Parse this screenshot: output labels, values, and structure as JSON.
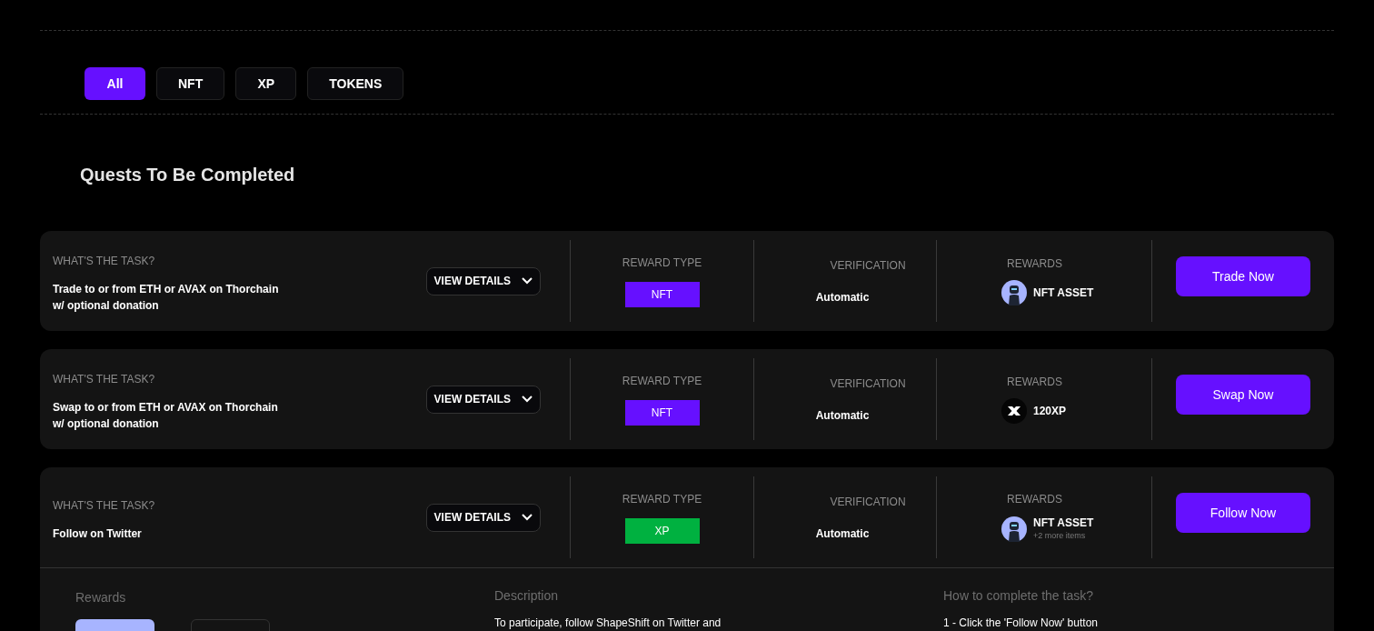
{
  "filters": [
    {
      "label": "All",
      "selected": true
    },
    {
      "label": "NFT",
      "selected": false
    },
    {
      "label": "XP",
      "selected": false
    },
    {
      "label": "TOKENS",
      "selected": false
    }
  ],
  "section_title": "Quests To Be Completed",
  "quests": [
    {
      "task_label": "WHAT'S THE TASK?",
      "task": "Trade to or from ETH or AVAX on Thorchain w/ optional donation",
      "details_button": "VIEW DETAILS",
      "reward_type_label": "REWARD TYPE",
      "reward_type": {
        "kind": "nft",
        "label": "NFT"
      },
      "verification_label": "VERIFICATION",
      "verification": "Automatic",
      "rewards_label": "REWARDS",
      "reward": {
        "kind": "nft",
        "name": "NFT ASSET"
      },
      "action": "Trade Now",
      "expanded": false
    },
    {
      "task_label": "WHAT'S THE TASK?",
      "task": "Swap to or from ETH or AVAX on Thorchain w/ optional donation",
      "details_button": "VIEW DETAILS",
      "reward_type_label": "REWARD TYPE",
      "reward_type": {
        "kind": "nft",
        "label": "NFT"
      },
      "verification_label": "VERIFICATION",
      "verification": "Automatic",
      "rewards_label": "REWARDS",
      "reward": {
        "kind": "xp",
        "name": "120XP"
      },
      "action": "Swap Now",
      "expanded": false
    },
    {
      "task_label": "WHAT'S THE TASK?",
      "task": "Follow on Twitter",
      "details_button": "VIEW DETAILS",
      "reward_type_label": "REWARD TYPE",
      "reward_type": {
        "kind": "xp",
        "label": "XP"
      },
      "verification_label": "VERIFICATION",
      "verification": "Automatic",
      "rewards_label": "REWARDS",
      "reward": {
        "kind": "nft",
        "name": "NFT ASSET",
        "more": "+2 more items"
      },
      "action": "Follow Now",
      "expanded": true,
      "details": {
        "rewards_heading": "Rewards",
        "description_heading": "Description",
        "description": "To participate, follow ShapeShift on Twitter and",
        "howto_heading": "How to complete the task?",
        "howto": "1 - Click the 'Follow Now' button"
      }
    }
  ]
}
